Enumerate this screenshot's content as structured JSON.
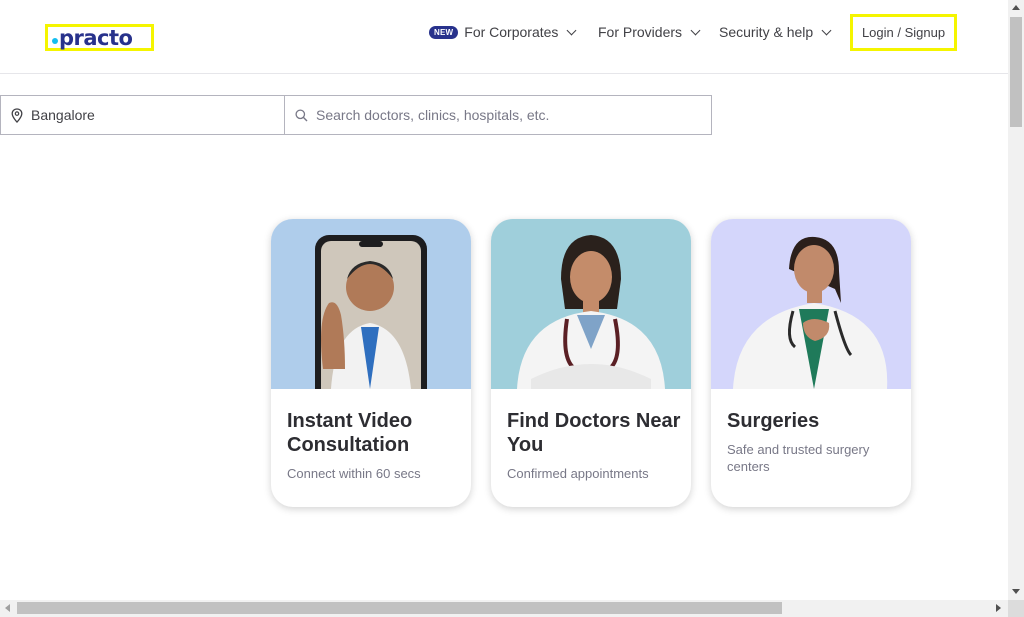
{
  "header": {
    "logo_text": "practo",
    "nav": {
      "corporates": {
        "badge": "NEW",
        "label": "For Corporates"
      },
      "providers": {
        "label": "For Providers"
      },
      "security": {
        "label": "Security & help"
      }
    },
    "login_label": "Login / Signup"
  },
  "search": {
    "location_value": "Bangalore",
    "query_placeholder": "Search doctors, clinics, hospitals, etc."
  },
  "cards": [
    {
      "title": "Instant Video Consultation",
      "subtitle": "Connect within 60 secs",
      "bg": "#afcdeb"
    },
    {
      "title": "Find Doctors Near You",
      "subtitle": "Confirmed appointments",
      "bg": "#9fcfdb"
    },
    {
      "title": "Surgeries",
      "subtitle": "Safe and trusted surgery centers",
      "bg": "#d4d6fb"
    }
  ],
  "colors": {
    "brand_navy": "#28328c",
    "brand_cyan": "#14bef0",
    "highlight": "#f5f500"
  },
  "icons": [
    "location-pin-icon",
    "search-icon",
    "chevron-down-icon"
  ]
}
